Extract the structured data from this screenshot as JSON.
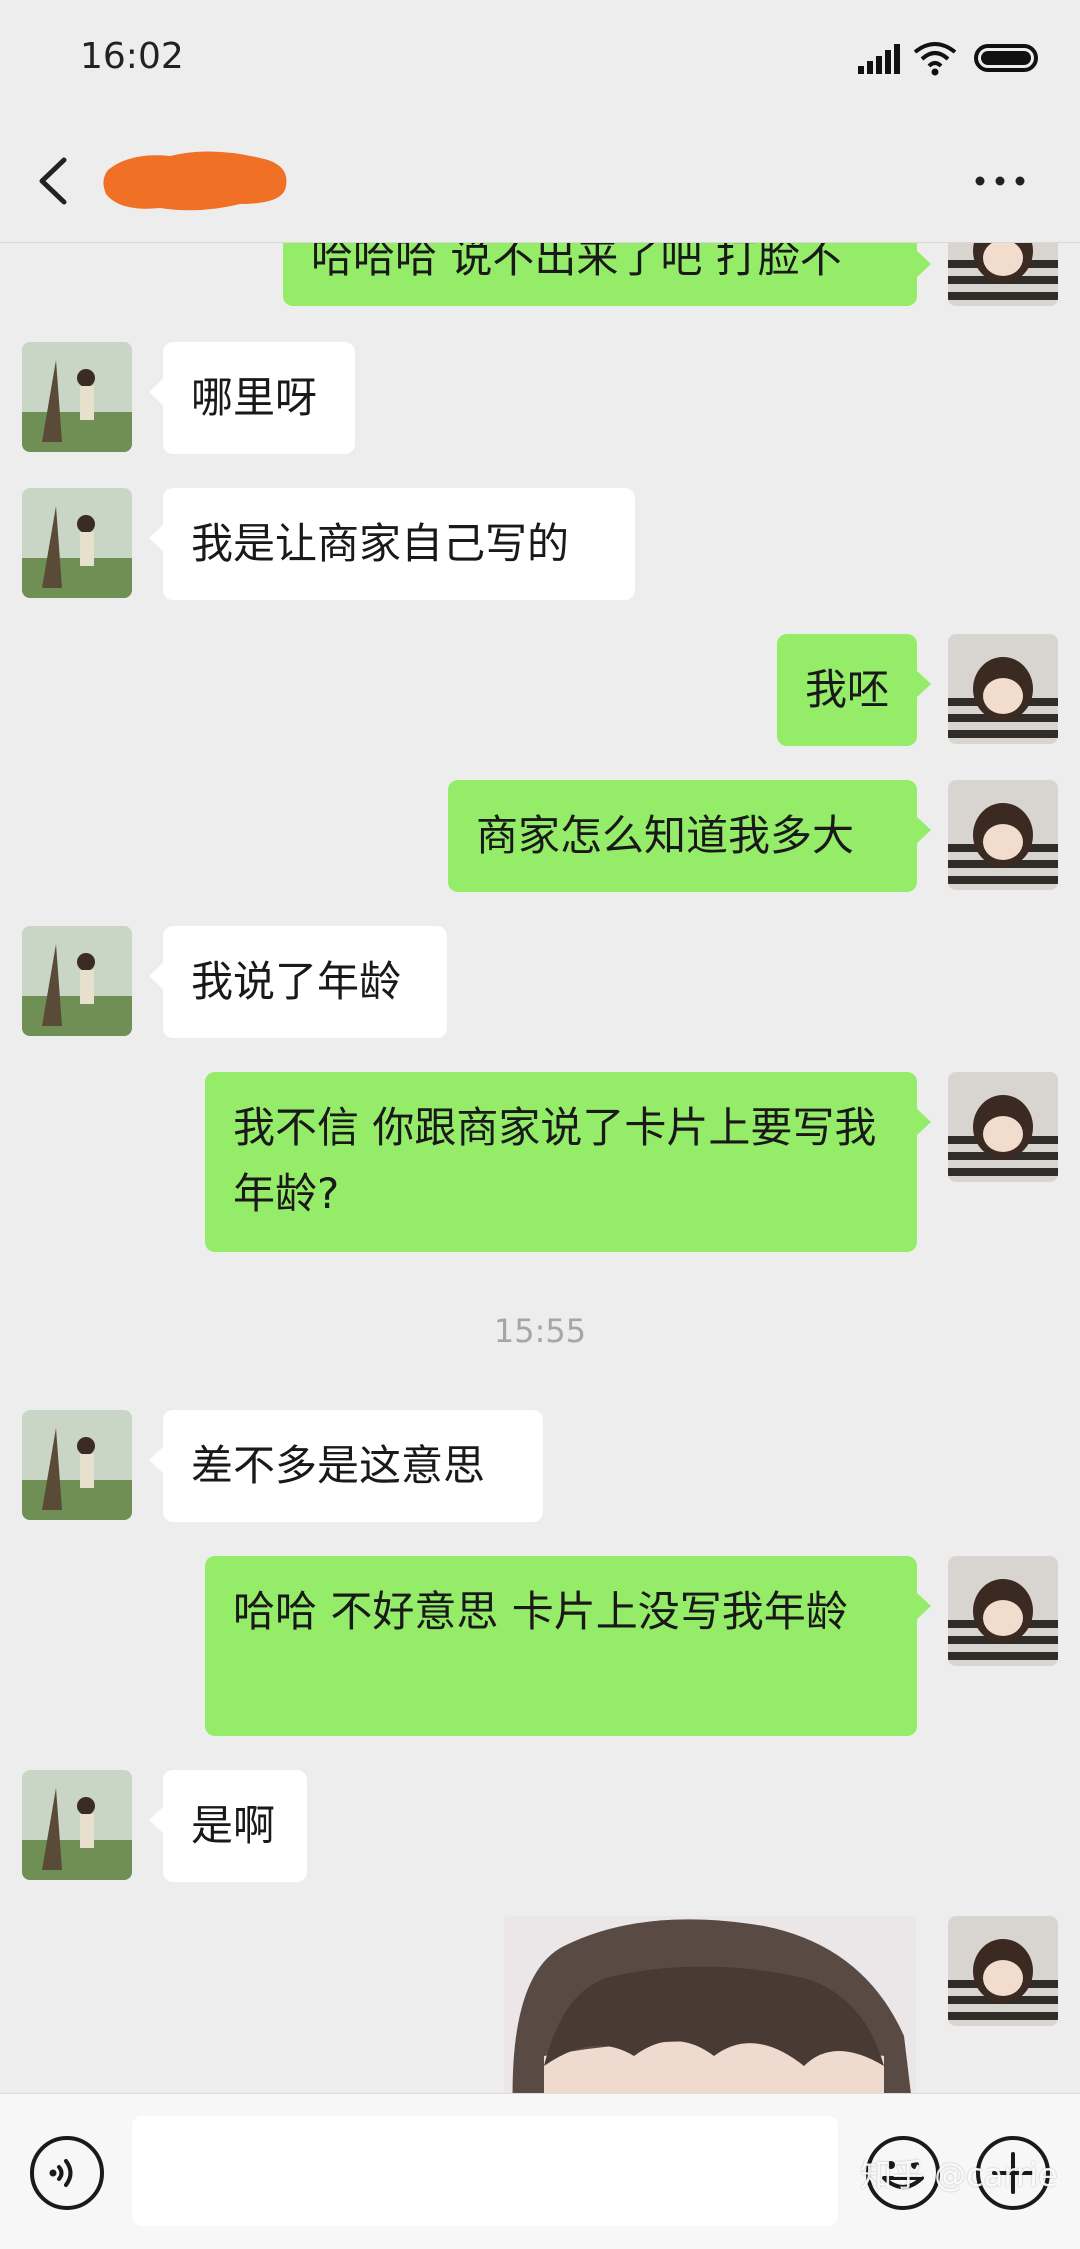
{
  "status_bar": {
    "time": "16:02"
  },
  "messages": [
    {
      "side": "right",
      "text": "哈哈哈 说不出来了吧 打脸不"
    },
    {
      "side": "left",
      "text": "哪里呀"
    },
    {
      "side": "left",
      "text": "我是让商家自己写的"
    },
    {
      "side": "right",
      "text": "我呸"
    },
    {
      "side": "right",
      "text": "商家怎么知道我多大"
    },
    {
      "side": "left",
      "text": "我说了年龄"
    },
    {
      "side": "right",
      "text": "我不信  你跟商家说了卡片上要写我年龄?"
    },
    {
      "timestamp": "15:55"
    },
    {
      "side": "left",
      "text": "差不多是这意思"
    },
    {
      "side": "right",
      "text": "哈哈  不好意思   卡片上没写我年龄"
    },
    {
      "side": "left",
      "text": "是啊"
    },
    {
      "side": "right",
      "type": "image"
    }
  ],
  "watermark": "知乎 @carrie",
  "colors": {
    "self_bubble": "#95ec69",
    "other_bubble": "#ffffff",
    "background": "#ededed",
    "redaction": "#f07025"
  }
}
